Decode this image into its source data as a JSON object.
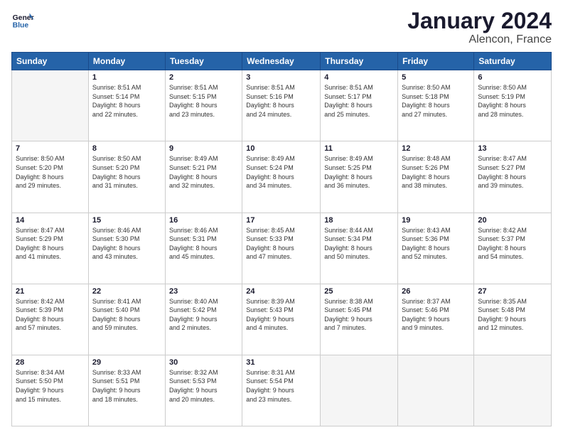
{
  "logo": {
    "text_general": "General",
    "text_blue": "Blue"
  },
  "header": {
    "title": "January 2024",
    "subtitle": "Alencon, France"
  },
  "days_header": [
    "Sunday",
    "Monday",
    "Tuesday",
    "Wednesday",
    "Thursday",
    "Friday",
    "Saturday"
  ],
  "weeks": [
    [
      {
        "day": "",
        "info": ""
      },
      {
        "day": "1",
        "info": "Sunrise: 8:51 AM\nSunset: 5:14 PM\nDaylight: 8 hours\nand 22 minutes."
      },
      {
        "day": "2",
        "info": "Sunrise: 8:51 AM\nSunset: 5:15 PM\nDaylight: 8 hours\nand 23 minutes."
      },
      {
        "day": "3",
        "info": "Sunrise: 8:51 AM\nSunset: 5:16 PM\nDaylight: 8 hours\nand 24 minutes."
      },
      {
        "day": "4",
        "info": "Sunrise: 8:51 AM\nSunset: 5:17 PM\nDaylight: 8 hours\nand 25 minutes."
      },
      {
        "day": "5",
        "info": "Sunrise: 8:50 AM\nSunset: 5:18 PM\nDaylight: 8 hours\nand 27 minutes."
      },
      {
        "day": "6",
        "info": "Sunrise: 8:50 AM\nSunset: 5:19 PM\nDaylight: 8 hours\nand 28 minutes."
      }
    ],
    [
      {
        "day": "7",
        "info": ""
      },
      {
        "day": "8",
        "info": "Sunrise: 8:50 AM\nSunset: 5:20 PM\nDaylight: 8 hours\nand 31 minutes."
      },
      {
        "day": "9",
        "info": "Sunrise: 8:49 AM\nSunset: 5:21 PM\nDaylight: 8 hours\nand 32 minutes."
      },
      {
        "day": "10",
        "info": "Sunrise: 8:49 AM\nSunset: 5:24 PM\nDaylight: 8 hours\nand 34 minutes."
      },
      {
        "day": "11",
        "info": "Sunrise: 8:49 AM\nSunset: 5:25 PM\nDaylight: 8 hours\nand 36 minutes."
      },
      {
        "day": "12",
        "info": "Sunrise: 8:48 AM\nSunset: 5:26 PM\nDaylight: 8 hours\nand 38 minutes."
      },
      {
        "day": "13",
        "info": "Sunrise: 8:47 AM\nSunset: 5:27 PM\nDaylight: 8 hours\nand 39 minutes."
      }
    ],
    [
      {
        "day": "14",
        "info": ""
      },
      {
        "day": "15",
        "info": "Sunrise: 8:46 AM\nSunset: 5:30 PM\nDaylight: 8 hours\nand 43 minutes."
      },
      {
        "day": "16",
        "info": "Sunrise: 8:46 AM\nSunset: 5:31 PM\nDaylight: 8 hours\nand 45 minutes."
      },
      {
        "day": "17",
        "info": "Sunrise: 8:45 AM\nSunset: 5:33 PM\nDaylight: 8 hours\nand 47 minutes."
      },
      {
        "day": "18",
        "info": "Sunrise: 8:44 AM\nSunset: 5:34 PM\nDaylight: 8 hours\nand 50 minutes."
      },
      {
        "day": "19",
        "info": "Sunrise: 8:43 AM\nSunset: 5:36 PM\nDaylight: 8 hours\nand 52 minutes."
      },
      {
        "day": "20",
        "info": "Sunrise: 8:42 AM\nSunset: 5:37 PM\nDaylight: 8 hours\nand 54 minutes."
      }
    ],
    [
      {
        "day": "21",
        "info": ""
      },
      {
        "day": "22",
        "info": "Sunrise: 8:41 AM\nSunset: 5:40 PM\nDaylight: 8 hours\nand 59 minutes."
      },
      {
        "day": "23",
        "info": "Sunrise: 8:40 AM\nSunset: 5:42 PM\nDaylight: 9 hours\nand 2 minutes."
      },
      {
        "day": "24",
        "info": "Sunrise: 8:39 AM\nSunset: 5:43 PM\nDaylight: 9 hours\nand 4 minutes."
      },
      {
        "day": "25",
        "info": "Sunrise: 8:38 AM\nSunset: 5:45 PM\nDaylight: 9 hours\nand 7 minutes."
      },
      {
        "day": "26",
        "info": "Sunrise: 8:37 AM\nSunset: 5:46 PM\nDaylight: 9 hours\nand 9 minutes."
      },
      {
        "day": "27",
        "info": "Sunrise: 8:35 AM\nSunset: 5:48 PM\nDaylight: 9 hours\nand 12 minutes."
      }
    ],
    [
      {
        "day": "28",
        "info": "Sunrise: 8:34 AM\nSunset: 5:50 PM\nDaylight: 9 hours\nand 15 minutes."
      },
      {
        "day": "29",
        "info": "Sunrise: 8:33 AM\nSunset: 5:51 PM\nDaylight: 9 hours\nand 18 minutes."
      },
      {
        "day": "30",
        "info": "Sunrise: 8:32 AM\nSunset: 5:53 PM\nDaylight: 9 hours\nand 20 minutes."
      },
      {
        "day": "31",
        "info": "Sunrise: 8:31 AM\nSunset: 5:54 PM\nDaylight: 9 hours\nand 23 minutes."
      },
      {
        "day": "",
        "info": ""
      },
      {
        "day": "",
        "info": ""
      },
      {
        "day": "",
        "info": ""
      }
    ]
  ],
  "week_day7_sunday_info": "Daylight: 8 hours\nand 29 minutes.",
  "week2_sunday_info": "Sunrise: 8:50 AM\nSunset: 5:20 PM\nDaylight: 8 hours\nand 29 minutes.",
  "week3_sunday_info": "Sunrise: 8:47 AM\nSunset: 5:29 PM\nDaylight: 8 hours\nand 41 minutes.",
  "week4_sunday_info": "Sunrise: 8:42 AM\nSunset: 5:39 PM\nDaylight: 8 hours\nand 57 minutes."
}
